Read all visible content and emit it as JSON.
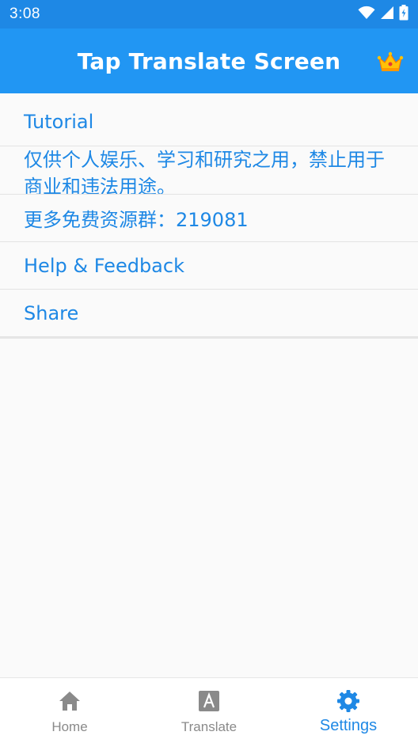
{
  "status_bar": {
    "time": "3:08",
    "icons": [
      "wifi-icon",
      "cell-signal-icon",
      "battery-charging-icon"
    ]
  },
  "app_bar": {
    "title": "Tap Translate Screen",
    "action_icon": "crown-icon"
  },
  "settings": {
    "items": [
      {
        "label": "Tutorial"
      },
      {
        "label": "仅供个人娱乐、学习和研究之用，禁止用于商业和违法用途。"
      },
      {
        "label": "更多免费资源群：219081"
      },
      {
        "label": "Help & Feedback"
      },
      {
        "label": "Share"
      }
    ]
  },
  "bottom_nav": {
    "items": [
      {
        "label": "Home",
        "icon": "home-icon",
        "active": false
      },
      {
        "label": "Translate",
        "icon": "translate-icon",
        "active": false
      },
      {
        "label": "Settings",
        "icon": "gear-icon",
        "active": true
      }
    ]
  },
  "colors": {
    "app_bar": "#2196f3",
    "status_bar": "#1e88e5",
    "accent": "#1e88e5",
    "inactive": "#8a8a8a",
    "background": "#fafafa"
  }
}
